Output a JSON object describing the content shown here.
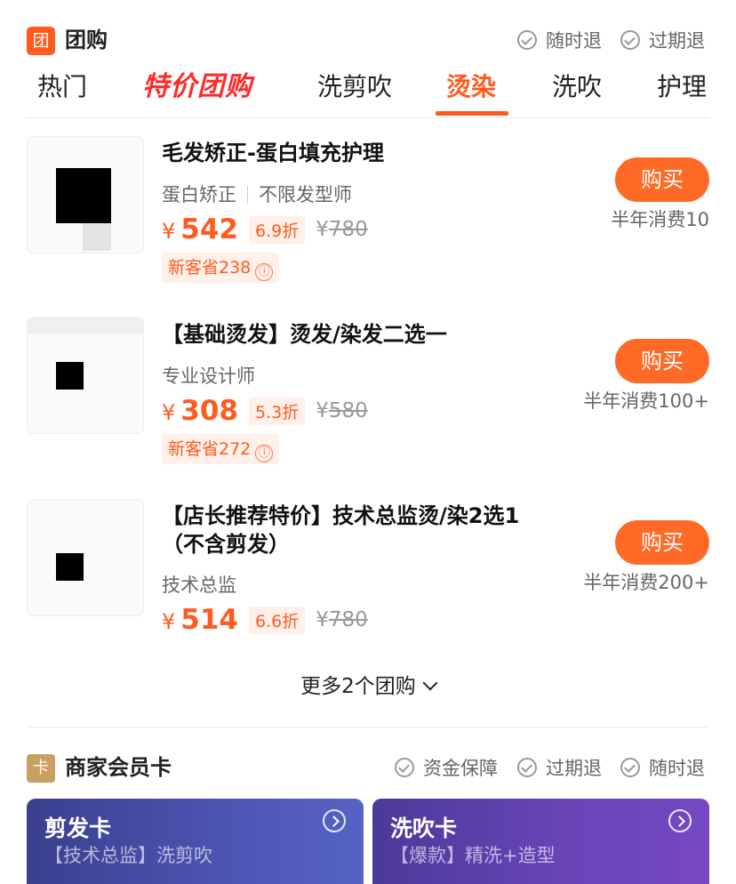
{
  "header": {
    "badge": "团",
    "title": "团购",
    "guarantees": [
      "随时退",
      "过期退"
    ]
  },
  "tabs": [
    {
      "label": "热门"
    },
    {
      "label": "特价团购"
    },
    {
      "label": "洗剪吹"
    },
    {
      "label": "烫染"
    },
    {
      "label": "洗吹"
    },
    {
      "label": "护理"
    }
  ],
  "active_tab": "烫染",
  "accent_color": "#ff5b1f",
  "deals": [
    {
      "title": "毛发矫正-蛋白填充护理",
      "tags": [
        "蛋白矫正",
        "不限发型师"
      ],
      "price": "542",
      "currency": "¥",
      "discount": "6.9折",
      "original_price": "780",
      "coupon": "新客省238",
      "button": "购买",
      "sales": "半年消费10"
    },
    {
      "title": "【基础烫发】烫发/染发二选一",
      "tags": [
        "专业设计师"
      ],
      "price": "308",
      "currency": "¥",
      "discount": "5.3折",
      "original_price": "580",
      "coupon": "新客省272",
      "button": "购买",
      "sales": "半年消费100+"
    },
    {
      "title": "【店长推荐特价】技术总监烫/染2选1（不含剪发）",
      "tags": [
        "技术总监"
      ],
      "price": "514",
      "currency": "¥",
      "discount": "6.6折",
      "original_price": "780",
      "button": "购买",
      "sales": "半年消费200+"
    }
  ],
  "more_link": "更多2个团购",
  "membership": {
    "badge": "卡",
    "title": "商家会员卡",
    "guarantees": [
      "资金保障",
      "过期退",
      "随时退"
    ],
    "cards": [
      {
        "title": "剪发卡",
        "subtitle": "【技术总监】洗剪吹"
      },
      {
        "title": "洗吹卡",
        "subtitle": "【爆款】精洗+造型"
      }
    ]
  },
  "info_icon": "ⓘ"
}
